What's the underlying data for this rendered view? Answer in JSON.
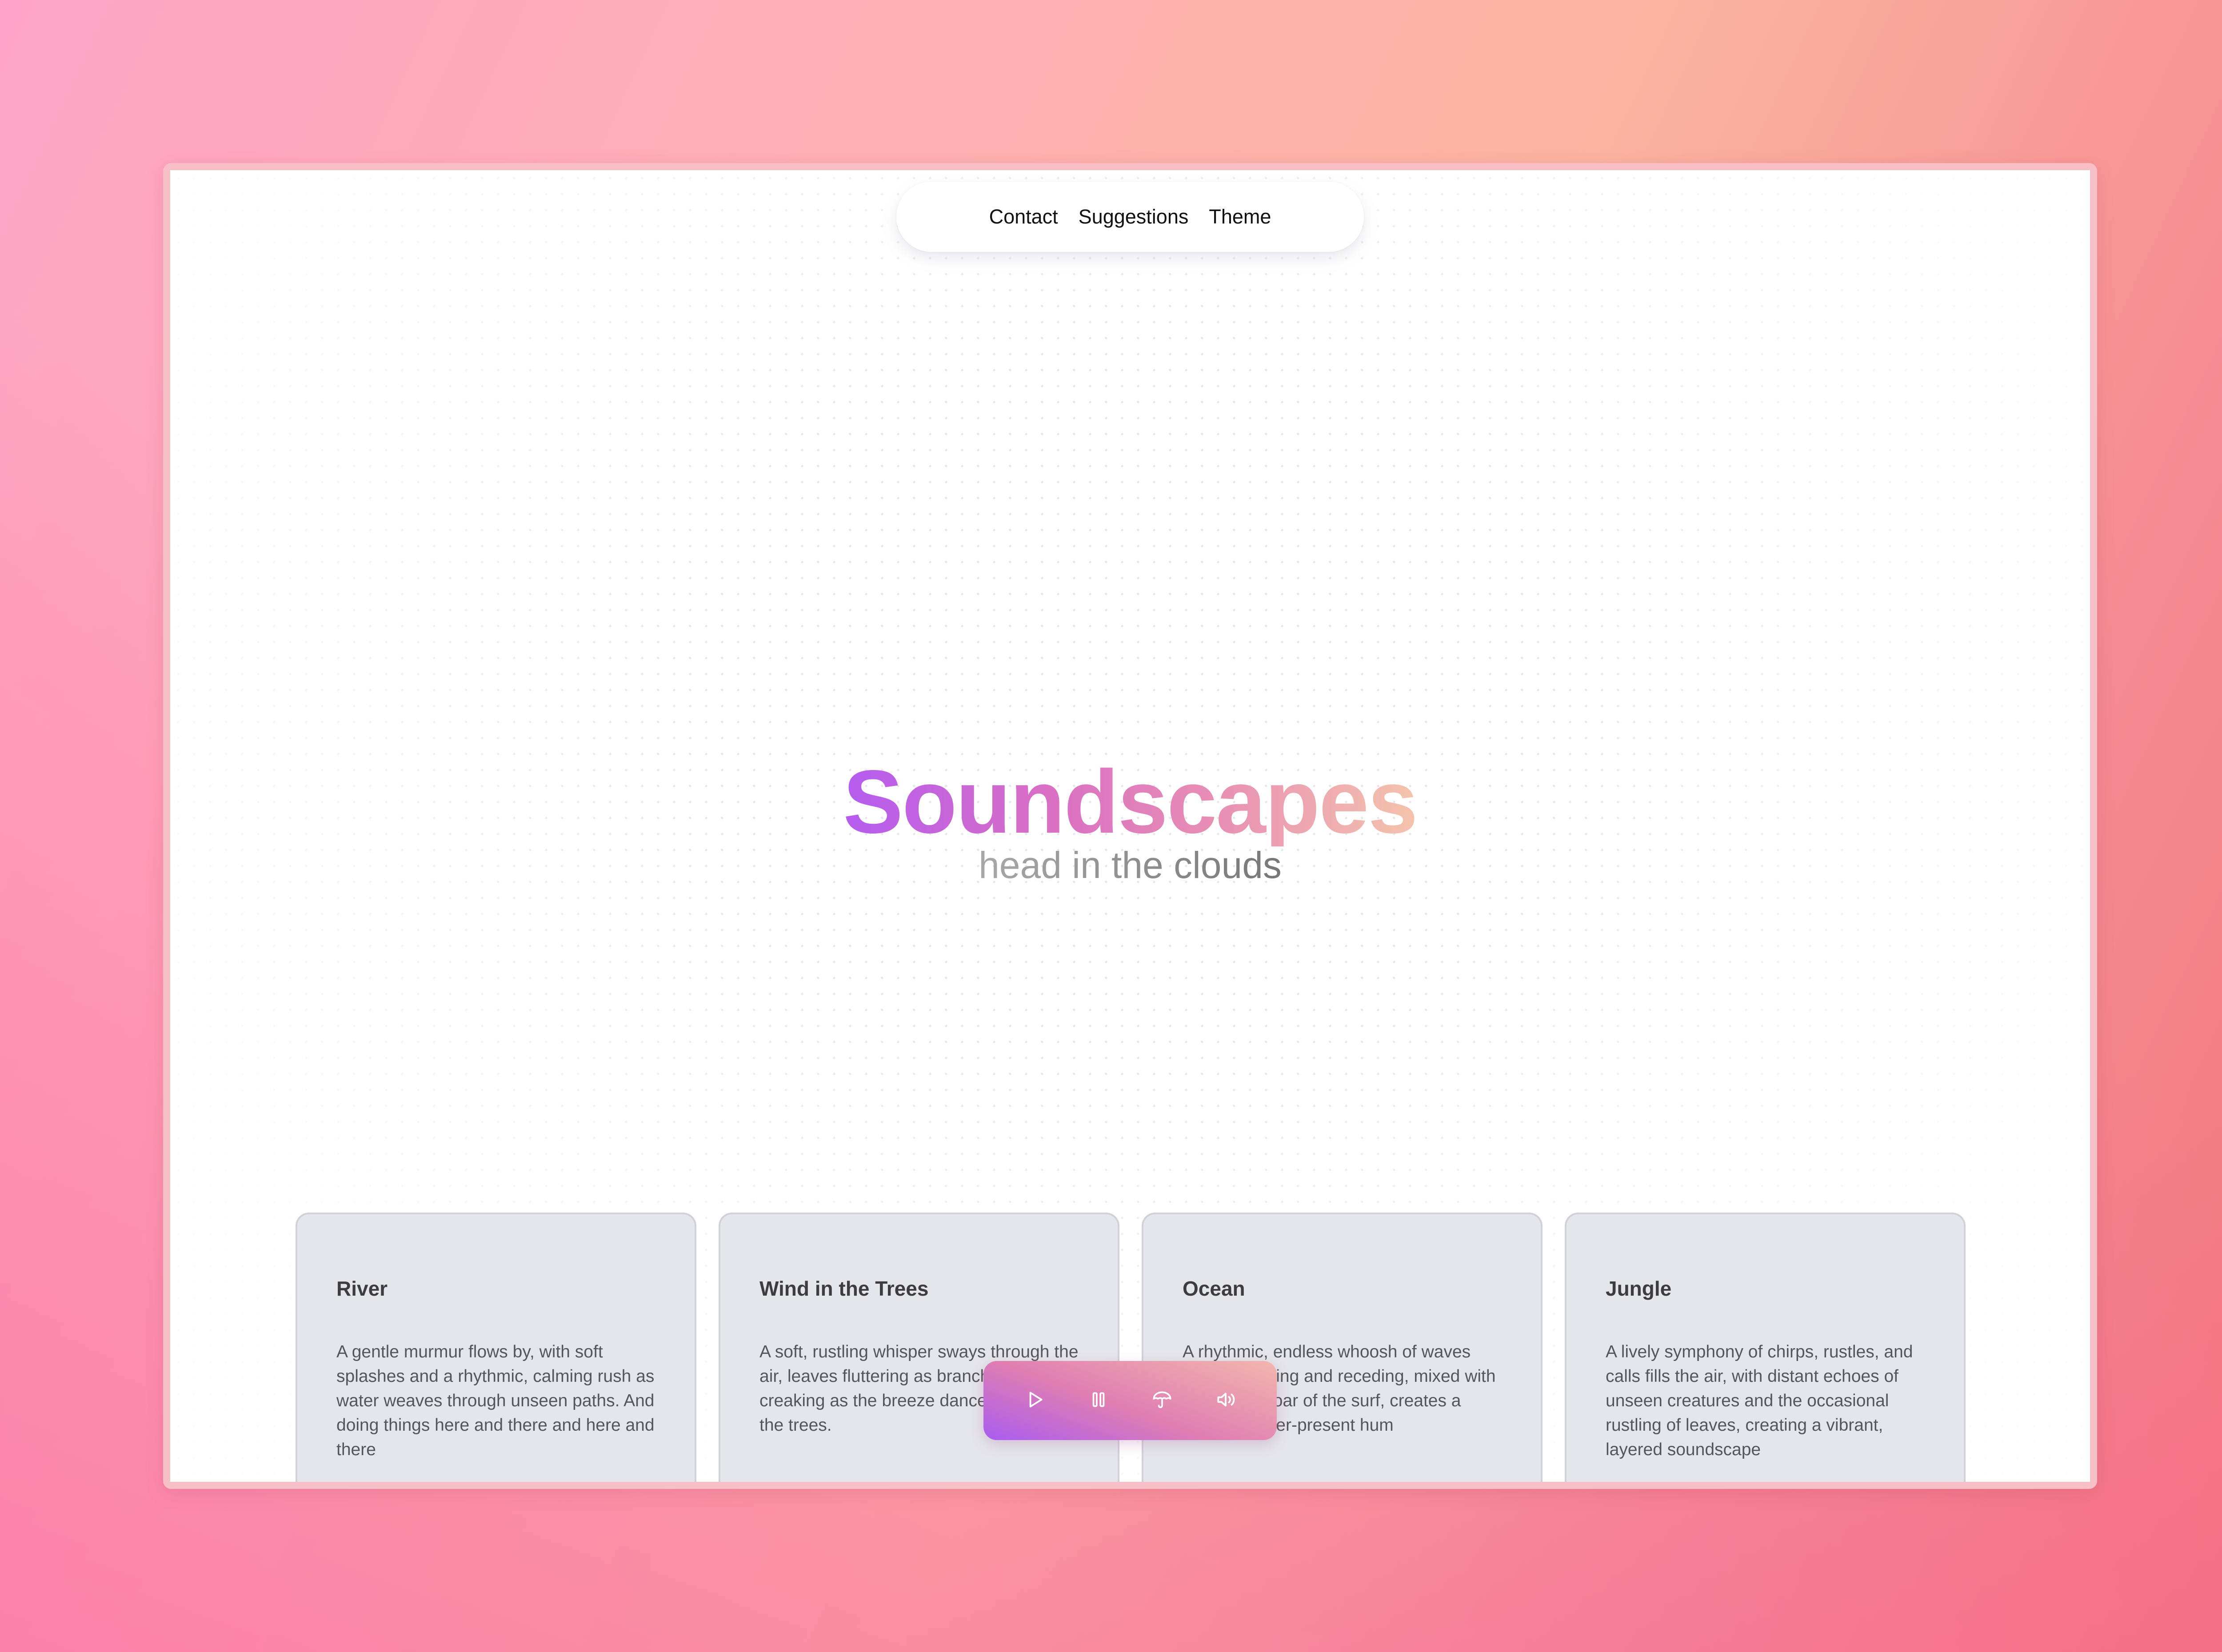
{
  "nav": {
    "links": [
      "Contact",
      "Suggestions",
      "Theme"
    ]
  },
  "hero": {
    "title": "Soundscapes",
    "subtitle": "head in the clouds"
  },
  "cards": [
    {
      "title": "River",
      "description": "A gentle murmur flows by, with soft splashes and a rhythmic, calming rush as water weaves through unseen paths. And doing things here and there and here and there"
    },
    {
      "title": "Wind in the Trees",
      "description": "A soft, rustling whisper sways through the air, leaves fluttering as branches gently creaking as the breeze dances through the trees."
    },
    {
      "title": "Ocean",
      "description": "A rhythmic, endless whoosh of waves gently crashing and receding, mixed with the distant roar of the surf, creates a soothing, ever-present hum"
    },
    {
      "title": "Jungle",
      "description": "A lively symphony of chirps, rustles, and calls fills the air, with distant echoes of unseen creatures and the occasional rustling of leaves, creating a vibrant, layered soundscape"
    }
  ],
  "player": {
    "controls": [
      "play-icon",
      "pause-icon",
      "umbrella-icon",
      "volume-icon"
    ]
  },
  "colors": {
    "title_gradient": [
      "#b45cf0",
      "#d96ec4",
      "#e88fb4",
      "#f4c4ac"
    ],
    "player_gradient": [
      "#a95cf0",
      "#e07eb2",
      "#f2b7ad"
    ],
    "card_bg": "#e5e6e9"
  }
}
